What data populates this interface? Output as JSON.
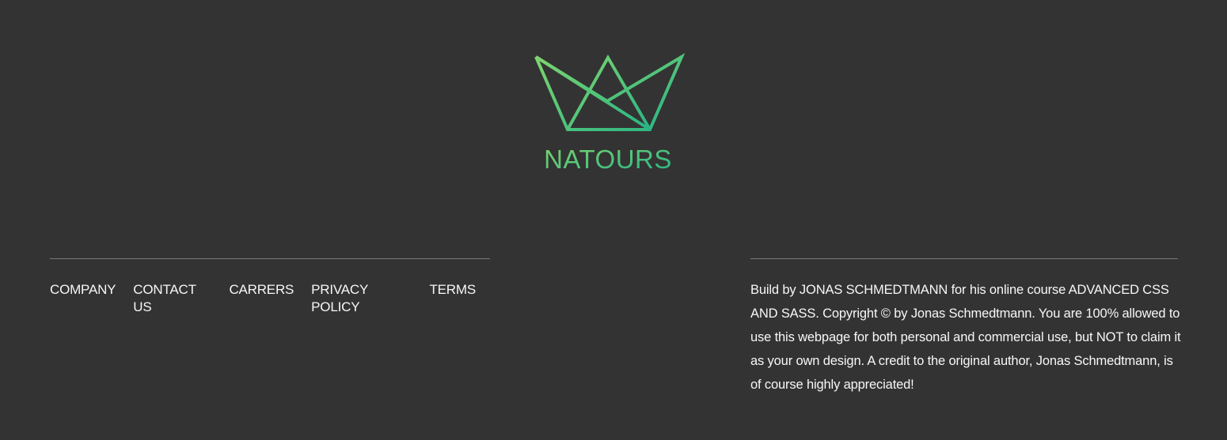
{
  "brand": {
    "name": "NATOURS",
    "gradient_start": "#7ed56f",
    "gradient_end": "#28b485"
  },
  "nav": {
    "items": [
      {
        "label": "COMPANY"
      },
      {
        "label": "CONTACT US"
      },
      {
        "label": "CARRERS"
      },
      {
        "label": "PRIVACY POLICY"
      },
      {
        "label": "TERMS"
      }
    ]
  },
  "copyright": {
    "text": "Build by JONAS SCHMEDTMANN for his online course ADVANCED CSS AND SASS. Copyright © by Jonas Schmedtmann. You are 100% allowed to use this webpage for both personal and commercial use, but NOT to claim it as your own design. A credit to the original author, Jonas Schmedtmann, is of course highly appreciated!"
  },
  "theme": {
    "background": "#333333",
    "text": "#f7f7f7",
    "divider": "#777777"
  }
}
